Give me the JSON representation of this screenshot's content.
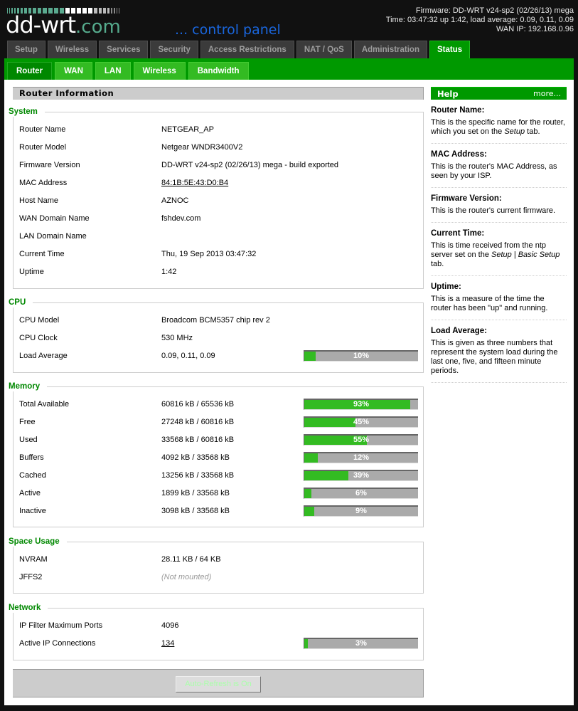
{
  "header": {
    "logo_main": "dd-wrt",
    "logo_suffix": ".com",
    "logo_subtitle": "... control panel",
    "firmware_line": "Firmware: DD-WRT v24-sp2 (02/26/13) mega",
    "time_line": "Time: 03:47:32 up 1:42, load average: 0.09, 0.11, 0.09",
    "wan_ip_line": "WAN IP: 192.168.0.96"
  },
  "main_tabs": [
    {
      "label": "Setup",
      "active": false
    },
    {
      "label": "Wireless",
      "active": false
    },
    {
      "label": "Services",
      "active": false
    },
    {
      "label": "Security",
      "active": false
    },
    {
      "label": "Access Restrictions",
      "active": false
    },
    {
      "label": "NAT / QoS",
      "active": false
    },
    {
      "label": "Administration",
      "active": false
    },
    {
      "label": "Status",
      "active": true
    }
  ],
  "sub_tabs": [
    {
      "label": "Router",
      "active": true
    },
    {
      "label": "WAN",
      "active": false
    },
    {
      "label": "LAN",
      "active": false
    },
    {
      "label": "Wireless",
      "active": false
    },
    {
      "label": "Bandwidth",
      "active": false
    }
  ],
  "page_title": "Router Information",
  "system": {
    "legend": "System",
    "rows": [
      {
        "label": "Router Name",
        "value": "NETGEAR_AP"
      },
      {
        "label": "Router Model",
        "value": "Netgear WNDR3400V2"
      },
      {
        "label": "Firmware Version",
        "value": "DD-WRT v24-sp2 (02/26/13) mega - build exported"
      },
      {
        "label": "MAC Address",
        "value": "84:1B:5E:43:D0:B4"
      },
      {
        "label": "Host Name",
        "value": "AZNOC"
      },
      {
        "label": "WAN Domain Name",
        "value": "fshdev.com"
      },
      {
        "label": "LAN Domain Name",
        "value": ""
      },
      {
        "label": "Current Time",
        "value": "Thu, 19 Sep 2013 03:47:32"
      },
      {
        "label": "Uptime",
        "value": "1:42"
      }
    ]
  },
  "cpu": {
    "legend": "CPU",
    "rows": [
      {
        "label": "CPU Model",
        "value": "Broadcom BCM5357 chip rev 2"
      },
      {
        "label": "CPU Clock",
        "value": "530 MHz"
      },
      {
        "label": "Load Average",
        "value": "0.09, 0.11, 0.09",
        "percent": 10,
        "percent_label": "10%"
      }
    ]
  },
  "memory": {
    "legend": "Memory",
    "rows": [
      {
        "label": "Total Available",
        "value": "60816 kB / 65536 kB",
        "percent": 93,
        "percent_label": "93%"
      },
      {
        "label": "Free",
        "value": "27248 kB / 60816 kB",
        "percent": 45,
        "percent_label": "45%"
      },
      {
        "label": "Used",
        "value": "33568 kB / 60816 kB",
        "percent": 55,
        "percent_label": "55%"
      },
      {
        "label": "Buffers",
        "value": "4092 kB / 33568 kB",
        "percent": 12,
        "percent_label": "12%"
      },
      {
        "label": "Cached",
        "value": "13256 kB / 33568 kB",
        "percent": 39,
        "percent_label": "39%"
      },
      {
        "label": "Active",
        "value": "1899 kB / 33568 kB",
        "percent": 6,
        "percent_label": "6%"
      },
      {
        "label": "Inactive",
        "value": "3098 kB / 33568 kB",
        "percent": 9,
        "percent_label": "9%"
      }
    ]
  },
  "space": {
    "legend": "Space Usage",
    "rows": [
      {
        "label": "NVRAM",
        "value": "28.11 KB / 64 KB"
      },
      {
        "label": "JFFS2",
        "value": "(Not mounted)"
      }
    ]
  },
  "network": {
    "legend": "Network",
    "rows": [
      {
        "label": "IP Filter Maximum Ports",
        "value": "4096"
      },
      {
        "label": "Active IP Connections",
        "value": "134",
        "percent": 3,
        "percent_label": "3%"
      }
    ]
  },
  "refresh_button": "Auto-Refresh is On",
  "help": {
    "title": "Help",
    "more": "more...",
    "items": [
      {
        "title": "Router Name:",
        "text_before": "This is the specific name for the router, which you set on the ",
        "em": "Setup",
        "text_after": " tab."
      },
      {
        "title": "MAC Address:",
        "text_before": "This is the router's MAC Address, as seen by your ISP.",
        "em": "",
        "text_after": ""
      },
      {
        "title": "Firmware Version:",
        "text_before": "This is the router's current firmware.",
        "em": "",
        "text_after": ""
      },
      {
        "title": "Current Time:",
        "text_before": "This is time received from the ntp server set on the ",
        "em": "Setup | Basic Setup",
        "text_after": " tab."
      },
      {
        "title": "Uptime:",
        "text_before": "This is a measure of the time the router has been \"up\" and running.",
        "em": "",
        "text_after": ""
      },
      {
        "title": "Load Average:",
        "text_before": "This is given as three numbers that represent the system load during the last one, five, and fifteen minute periods.",
        "em": "",
        "text_after": ""
      }
    ]
  },
  "colors": {
    "accent_green": "#009900",
    "bar_fill": "#33bb22",
    "bar_track": "#aaaaaa",
    "legend_green": "#008800",
    "subtitle_blue": "#1a66dd"
  }
}
